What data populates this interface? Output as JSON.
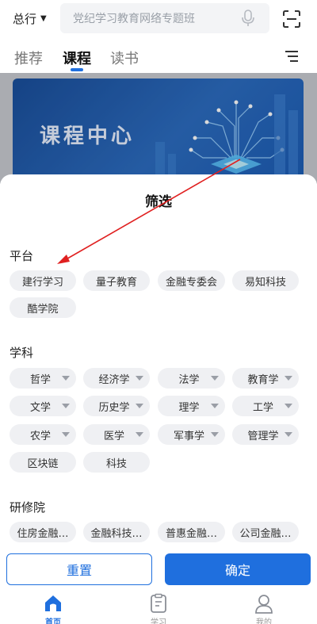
{
  "header": {
    "branch_label": "总行",
    "search_placeholder": "党纪学习教育网络专题班"
  },
  "tabs": [
    {
      "label": "推荐"
    },
    {
      "label": "课程"
    },
    {
      "label": "读书"
    }
  ],
  "banner": {
    "title": "课程中心"
  },
  "filter": {
    "title": "筛选",
    "platform": {
      "label": "平台",
      "options": [
        "建行学习",
        "量子教育",
        "金融专委会",
        "易知科技",
        "酷学院"
      ]
    },
    "subject": {
      "label": "学科",
      "options": [
        "哲学",
        "经济学",
        "法学",
        "教育学",
        "文学",
        "历史学",
        "理学",
        "工学",
        "农学",
        "医学",
        "军事学",
        "管理学",
        "区块链",
        "科技"
      ]
    },
    "institute": {
      "label": "研修院",
      "options": [
        "住房金融…",
        "金融科技…",
        "普惠金融…",
        "公司金融…"
      ]
    },
    "reset_label": "重置",
    "confirm_label": "确定"
  },
  "bottom_nav": [
    {
      "label": "首页"
    },
    {
      "label": "学习"
    },
    {
      "label": "我的"
    }
  ],
  "colors": {
    "accent": "#1f6fde",
    "annotation": "#e02020"
  }
}
